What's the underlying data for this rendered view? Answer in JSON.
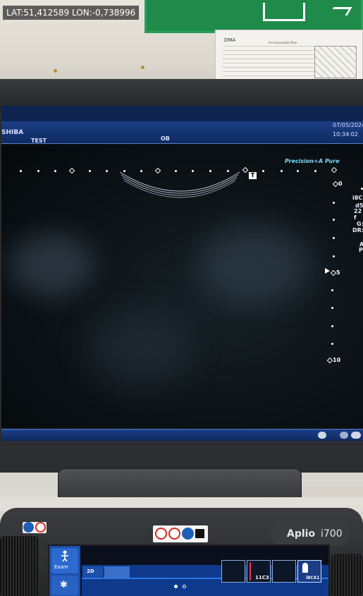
{
  "overlay": {
    "gps": "LAT:51,412589 LON:-0,738996"
  },
  "notice": {
    "title": "DMA",
    "subtitle": "Fire Evacuation Plan"
  },
  "monitor": {
    "brand": "SHIBA",
    "patient": "TEST",
    "preset": "OB",
    "date": "07/05/2024",
    "time": "10:34:02",
    "precision_label": "Precision+",
    "pure_label": "A Pure",
    "t_marker": "T",
    "depth_labels": [
      "0",
      "5",
      "10"
    ],
    "side_info": [
      "i8C",
      "d5",
      "22 f",
      "G:",
      "DR:",
      "A",
      "P:"
    ]
  },
  "console": {
    "brand_name": "Aplio",
    "model": "i700",
    "touch_panel": {
      "exam_label": "Exam",
      "mode_tab": "2D",
      "probes": [
        "",
        "11C3",
        "",
        "i8CX1"
      ],
      "page_indicator": {
        "pages": 2,
        "active": 1
      }
    }
  },
  "colors": {
    "screen_bar": "#1c3f86",
    "highlight_text": "#7fd9ff",
    "exit_sign": "#1f8a4a",
    "touch_blue": "#1b4fa8"
  }
}
